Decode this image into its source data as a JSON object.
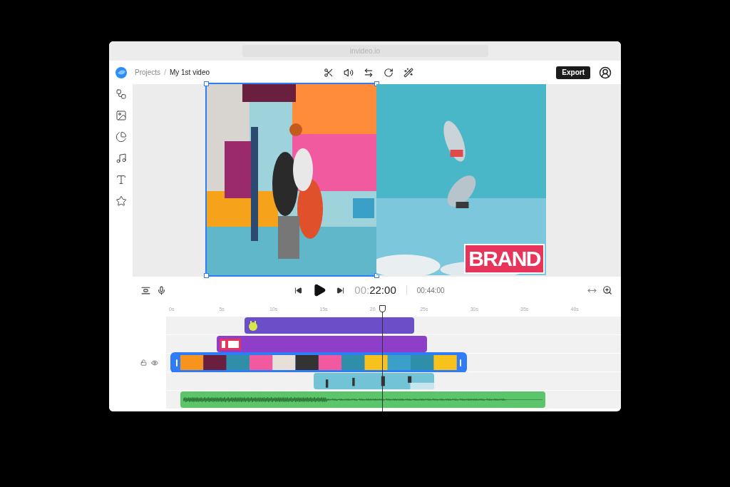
{
  "browser": {
    "url": "invideo.io"
  },
  "breadcrumb": [
    {
      "label": "Projects"
    },
    {
      "label": "My 1st video"
    }
  ],
  "breadcrumb_separator": "/",
  "export_button": "Export",
  "canvas": {
    "frames": [
      {
        "selected": true
      },
      {
        "selected": false
      }
    ],
    "overlay_text": "BRAND"
  },
  "player": {
    "current_time": "00:22:00",
    "duration": "00:44:00"
  },
  "ruler": [
    "0s",
    "5s",
    "10s",
    "15s",
    "20",
    "25s",
    "30s",
    "35s",
    "40s"
  ],
  "tracks": [
    {
      "kind": "sticker",
      "selected": false
    },
    {
      "kind": "title",
      "selected": false
    },
    {
      "kind": "video",
      "selected": true
    },
    {
      "kind": "overlay",
      "selected": false
    },
    {
      "kind": "audio",
      "selected": false
    }
  ]
}
